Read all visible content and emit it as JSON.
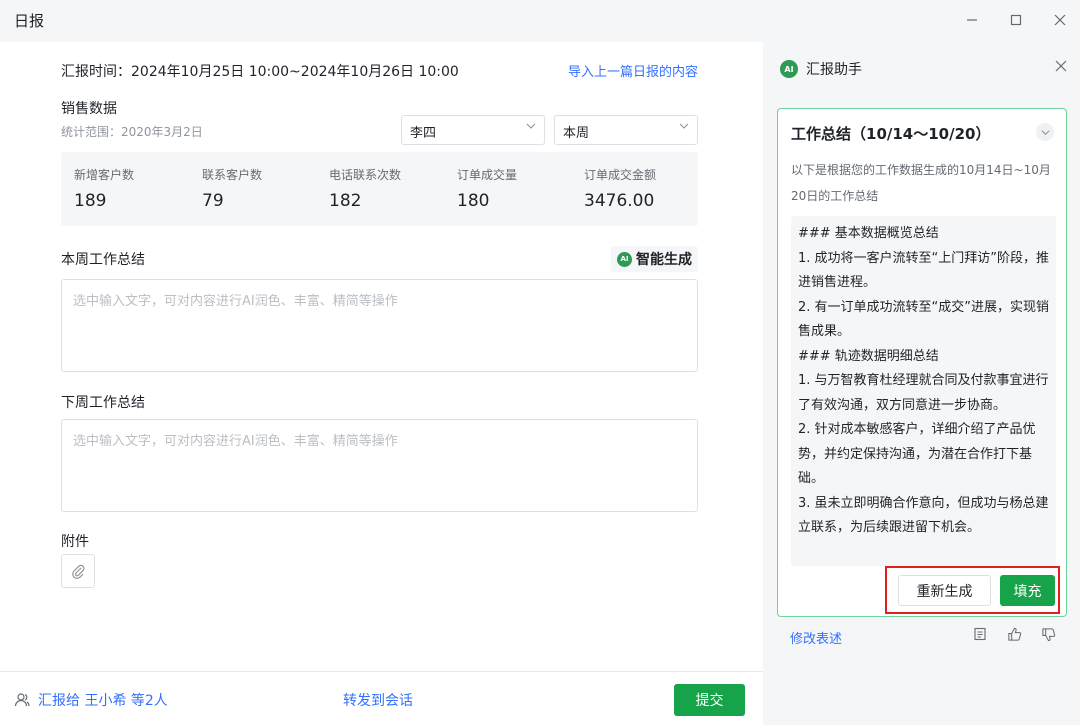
{
  "window": {
    "title": "日报"
  },
  "report": {
    "time_label": "汇报时间：2024年10月25日 10:00~2024年10月26日 10:00",
    "import_link": "导入上一篇日报的内容"
  },
  "sales": {
    "title": "销售数据",
    "range": "统计范围：2020年3月2日",
    "person_select": "李四",
    "period_select": "本周",
    "stats": [
      {
        "label": "新增客户数",
        "value": "189"
      },
      {
        "label": "联系客户数",
        "value": "79"
      },
      {
        "label": "电话联系次数",
        "value": "182"
      },
      {
        "label": "订单成交量",
        "value": "180"
      },
      {
        "label": "订单成交金额",
        "value": "3476.00"
      }
    ]
  },
  "this_week": {
    "title": "本周工作总结",
    "ai_button": "智能生成",
    "placeholder": "选中输入文字，可对内容进行AI润色、丰富、精简等操作"
  },
  "next_week": {
    "title": "下周工作总结",
    "placeholder": "选中输入文字，可对内容进行AI润色、丰富、精简等操作"
  },
  "attachment": {
    "title": "附件"
  },
  "footer": {
    "report_to": "汇报给  王小希 等2人",
    "forward": "转发到会话",
    "submit": "提交"
  },
  "assistant": {
    "title": "汇报助手",
    "card_title": "工作总结（10/14～10/20）",
    "intro": "以下是根据您的工作数据生成的10月14日~10月20日的工作总结",
    "lines": [
      "### 基本数据概览总结",
      "1. 成功将一客户流转至“上门拜访”阶段，推进销售进程。",
      "2. 有一订单成功流转至“成交”进展，实现销售成果。",
      "### 轨迹数据明细总结",
      "1. 与万智教育杜经理就合同及付款事宜进行了有效沟通，双方同意进一步协商。",
      "2. 针对成本敏感客户，详细介绍了产品优势，并约定保持沟通，为潜在合作打下基础。",
      "3. 虽未立即明确合作意向，但成功与杨总建立联系，为后续跟进留下机会。"
    ],
    "regenerate": "重新生成",
    "fill": "填充",
    "modify": "修改表述"
  },
  "colors": {
    "accent": "#16a34a",
    "link": "#3370ff",
    "highlight": "#e02020"
  },
  "icons": [
    "ai-assistant-icon",
    "close-icon",
    "minimize-icon",
    "maximize-icon",
    "chevron-down-icon",
    "paperclip-icon",
    "user-icon",
    "copy-icon",
    "thumbs-up-icon",
    "thumbs-down-icon"
  ]
}
